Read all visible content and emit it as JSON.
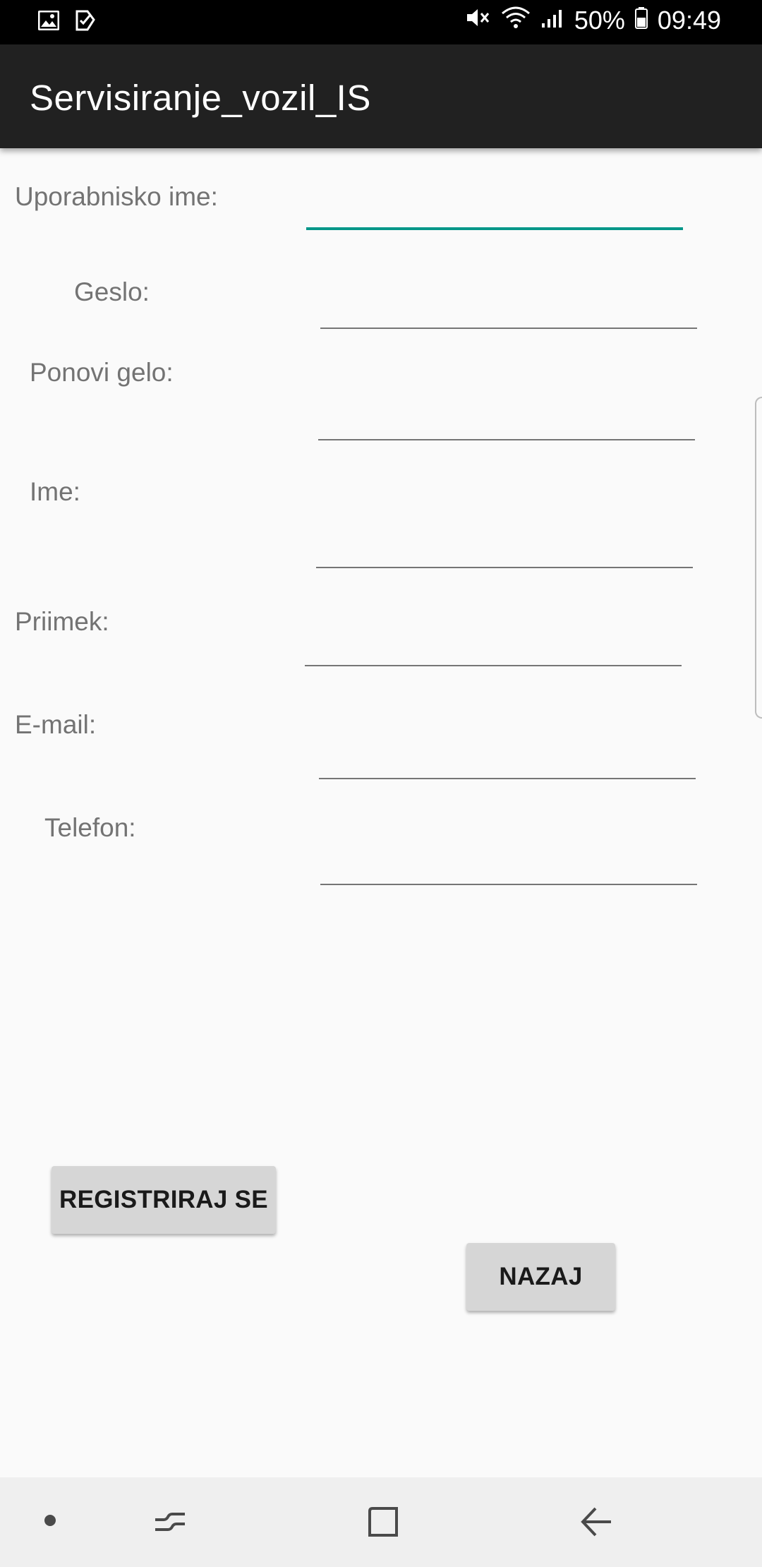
{
  "status_bar": {
    "battery_percent": "50%",
    "time": "09:49",
    "left_icons": [
      "gallery-icon",
      "checklist-icon"
    ],
    "right_icons": [
      "mute-icon",
      "wifi-icon",
      "signal-icon",
      "battery-icon"
    ]
  },
  "app_bar": {
    "title": "Servisiranje_vozil_IS"
  },
  "form": {
    "username_label": "Uporabnisko ime:",
    "username_value": "",
    "password_label": "Geslo:",
    "password_value": "",
    "repeat_password_label": "Ponovi gelo:",
    "repeat_password_value": "",
    "first_name_label": "Ime:",
    "first_name_value": "",
    "last_name_label": "Priimek:",
    "last_name_value": "",
    "email_label": "E-mail:",
    "email_value": "",
    "phone_label": "Telefon:",
    "phone_value": ""
  },
  "buttons": {
    "register_label": "REGISTRIRAJ SE",
    "back_label": "NAZAJ"
  },
  "nav_bar": {
    "items": [
      "dot-icon",
      "recents-icon",
      "home-icon",
      "back-icon"
    ]
  },
  "colors": {
    "accent": "#009688",
    "app_bar": "#212121",
    "button": "#d6d6d6"
  }
}
